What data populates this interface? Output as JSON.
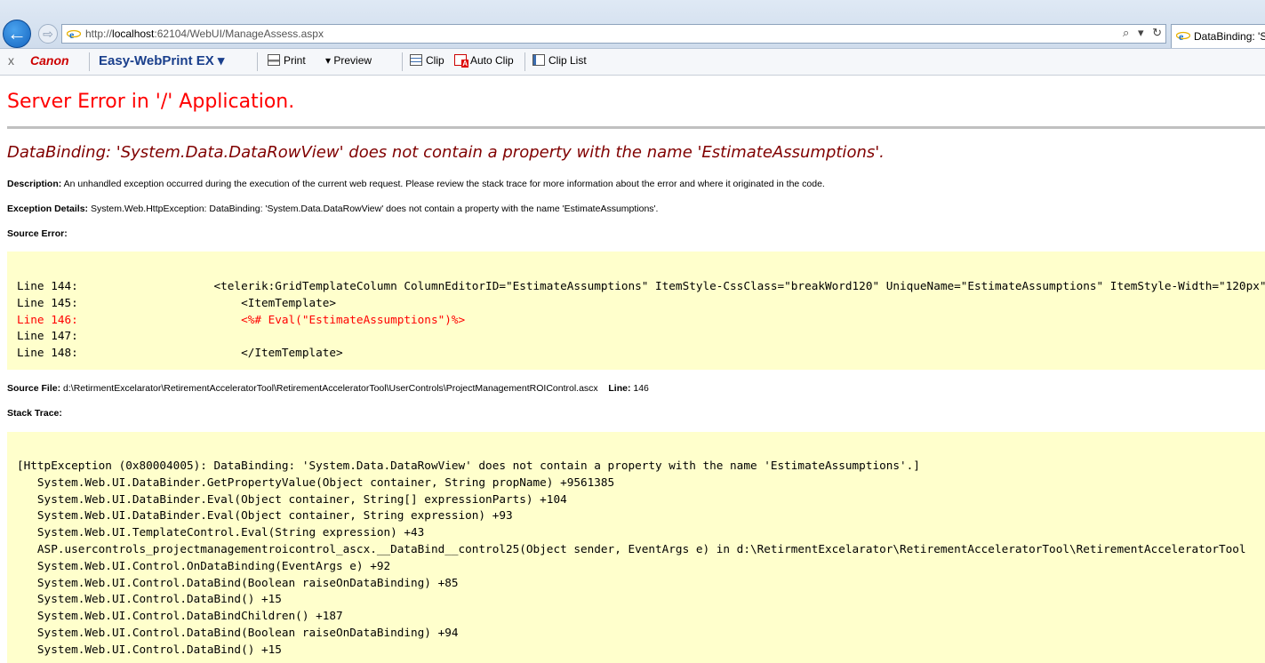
{
  "browser": {
    "url_prefix": "http://",
    "url_host": "localhost",
    "url_rest": ":62104/WebUI/ManageAssess.aspx",
    "search_icon": "⌕",
    "dropdown_icon": "▾",
    "refresh_icon": "↻",
    "tab_title": "DataBinding: 'S"
  },
  "toolbar": {
    "close_label": "x",
    "canon_label": "Canon",
    "ewp_label": "Easy-WebPrint EX ▾",
    "print_label": "Print",
    "preview_label": "▾ Preview",
    "clip_label": "Clip",
    "autoclip_label": "Auto Clip",
    "cliplist_label": "Clip List"
  },
  "error": {
    "title": "Server Error in '/' Application.",
    "message": "DataBinding: 'System.Data.DataRowView' does not contain a property with the name 'EstimateAssumptions'.",
    "description_label": "Description:",
    "description_text": " An unhandled exception occurred during the execution of the current web request. Please review the stack trace for more information about the error and where it originated in the code.",
    "exception_label": "Exception Details:",
    "exception_text": " System.Web.HttpException: DataBinding: 'System.Data.DataRowView' does not contain a property with the name 'EstimateAssumptions'.",
    "source_error_label": "Source Error:",
    "source_lines": [
      "Line 144:                    <telerik:GridTemplateColumn ColumnEditorID=\"EstimateAssumptions\" ItemStyle-CssClass=\"breakWord120\" UniqueName=\"EstimateAssumptions\" ItemStyle-Width=\"120px\"",
      "Line 145:                        <ItemTemplate>",
      "Line 146:                        <%# Eval(\"EstimateAssumptions\")%>",
      "Line 147:",
      "Line 148:                        </ItemTemplate>"
    ],
    "source_file_label": "Source File:",
    "source_file_path": " d:\\RetirmentExcelarator\\RetirementAcceleratorTool\\RetirementAcceleratorTool\\UserControls\\ProjectManagementROIControl.ascx",
    "line_label": "Line:",
    "line_number": " 146",
    "stack_trace_label": "Stack Trace:",
    "stack_lines": [
      "[HttpException (0x80004005): DataBinding: 'System.Data.DataRowView' does not contain a property with the name 'EstimateAssumptions'.]",
      "   System.Web.UI.DataBinder.GetPropertyValue(Object container, String propName) +9561385",
      "   System.Web.UI.DataBinder.Eval(Object container, String[] expressionParts) +104",
      "   System.Web.UI.DataBinder.Eval(Object container, String expression) +93",
      "   System.Web.UI.TemplateControl.Eval(String expression) +43",
      "   ASP.usercontrols_projectmanagementroicontrol_ascx.__DataBind__control25(Object sender, EventArgs e) in d:\\RetirmentExcelarator\\RetirementAcceleratorTool\\RetirementAcceleratorTool",
      "   System.Web.UI.Control.OnDataBinding(EventArgs e) +92",
      "   System.Web.UI.Control.DataBind(Boolean raiseOnDataBinding) +85",
      "   System.Web.UI.Control.DataBind() +15",
      "   System.Web.UI.Control.DataBindChildren() +187",
      "   System.Web.UI.Control.DataBind(Boolean raiseOnDataBinding) +94",
      "   System.Web.UI.Control.DataBind() +15"
    ]
  },
  "colors": {
    "title": "#ff0000",
    "message": "#800000",
    "code_background": "#ffffcc",
    "error_line": "#ff0000"
  }
}
